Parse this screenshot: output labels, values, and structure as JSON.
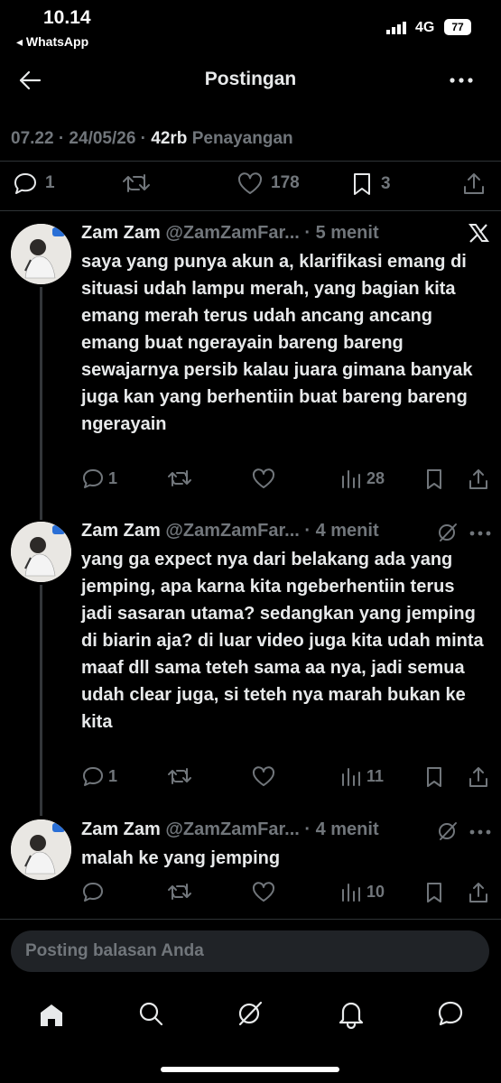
{
  "status_bar": {
    "time": "10.14",
    "back_app": "◂ WhatsApp",
    "carrier": "4G",
    "battery": "77"
  },
  "header": {
    "title": "Postingan"
  },
  "post_meta": {
    "time": "07.22 · 24/05/26 · ",
    "views_count": "42rb",
    "views_label": " Penayangan"
  },
  "post_actions": {
    "replies": "1",
    "likes": "178",
    "bookmarks": "3"
  },
  "replies": [
    {
      "name": "Zam Zam",
      "handle": "@ZamZamFar...",
      "time": "· 5 menit",
      "badge_icon": "x-logo-icon",
      "text": "saya yang punya akun a, klarifikasi emang di situasi udah lampu merah, yang bagian kita emang merah terus udah ancang ancang emang buat ngerayain bareng bareng sewajarnya persib kalau juara gimana banyak juga kan yang berhentiin buat bareng bareng ngerayain",
      "replies": "1",
      "views": "28"
    },
    {
      "name": "Zam Zam",
      "handle": "@ZamZamFar...",
      "time": "· 4 menit",
      "badge_icon": "grok-icon",
      "text": "yang ga expect nya dari belakang ada yang jemping, apa karna kita ngeberhentiin terus jadi sasaran utama? sedangkan yang jemping di biarin aja? di luar video juga kita udah minta maaf dll sama teteh sama aa nya, jadi semua udah clear juga, si teteh nya marah bukan ke kita",
      "replies": "1",
      "views": "11"
    },
    {
      "name": "Zam Zam",
      "handle": "@ZamZamFar...",
      "time": "· 4 menit",
      "badge_icon": "grok-icon",
      "text": "malah ke yang jemping",
      "replies": "",
      "views": "10"
    }
  ],
  "compose": {
    "placeholder": "Posting balasan Anda"
  },
  "bottom_nav": [
    "home-icon",
    "search-icon",
    "grok-icon",
    "notifications-icon",
    "messages-icon"
  ]
}
